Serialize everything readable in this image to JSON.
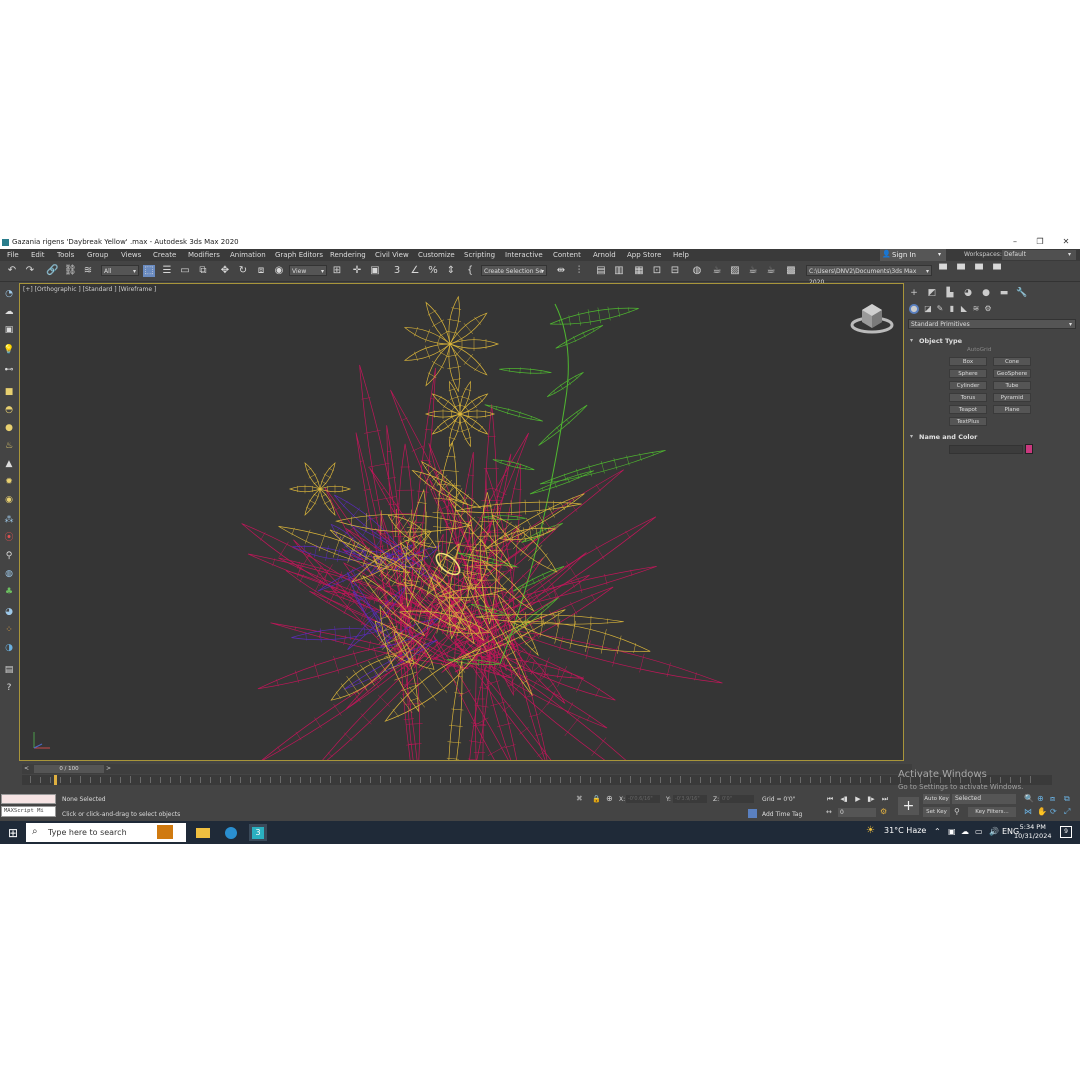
{
  "window": {
    "title": "Gazania rigens 'Daybreak Yellow' .max - Autodesk 3ds Max 2020",
    "minimize": "–",
    "maximize": "❐",
    "close": "✕"
  },
  "menu": [
    "File",
    "Edit",
    "Tools",
    "Group",
    "Views",
    "Create",
    "Modifiers",
    "Animation",
    "Graph Editors",
    "Rendering",
    "Civil View",
    "Customize",
    "Scripting",
    "Interactive",
    "Content",
    "Arnold",
    "App Store",
    "Help"
  ],
  "account": {
    "sign_in": "Sign In",
    "workspaces_label": "Workspaces:",
    "workspace": "Default"
  },
  "toolbar": {
    "selection_filter": "All",
    "ref_coord": "View",
    "named_selection": "Create Selection Se",
    "project_path": "C:\\Users\\DNV2\\Documents\\3ds Max 2020"
  },
  "viewport": {
    "label": "[+] [Orthographic ] [Standard ] [Wireframe ]",
    "colors": {
      "yellow": "#d9b43a",
      "crimson": "#c01659",
      "green": "#4fb830",
      "purple": "#5a2bb8",
      "frame": "#a8953a"
    }
  },
  "command_panel": {
    "category": "Standard Primitives",
    "object_type_title": "Object Type",
    "autogrid": "AutoGrid",
    "objects": [
      "Box",
      "Cone",
      "Sphere",
      "GeoSphere",
      "Cylinder",
      "Tube",
      "Torus",
      "Pyramid",
      "Teapot",
      "Plane",
      "TextPlus"
    ],
    "name_color_title": "Name and Color",
    "swatch_color": "#c9387e"
  },
  "timeline": {
    "frame": "0 / 100"
  },
  "status": {
    "maxscript": "MAXScript Mi",
    "selection": "None Selected",
    "prompt": "Click or click-and-drag to select objects",
    "x_label": "X:",
    "x_value": "-0'0.6/16\"",
    "y_label": "Y:",
    "y_value": "-0'3.9/16\"",
    "z_label": "Z:",
    "z_value": "0'0\"",
    "grid": "Grid = 0'0\"",
    "add_time_tag": "Add Time Tag",
    "frame_field": "0",
    "auto_key": "Auto Key",
    "set_key": "Set Key",
    "selected": "Selected",
    "key_filters": "Key Filters..."
  },
  "watermark": {
    "line1": "Activate Windows",
    "line2": "Go to Settings to activate Windows."
  },
  "taskbar": {
    "search_placeholder": "Type here to search",
    "weather": "31°C  Haze",
    "time": "5:34 PM",
    "date": "10/31/2024",
    "notifications": "9"
  }
}
